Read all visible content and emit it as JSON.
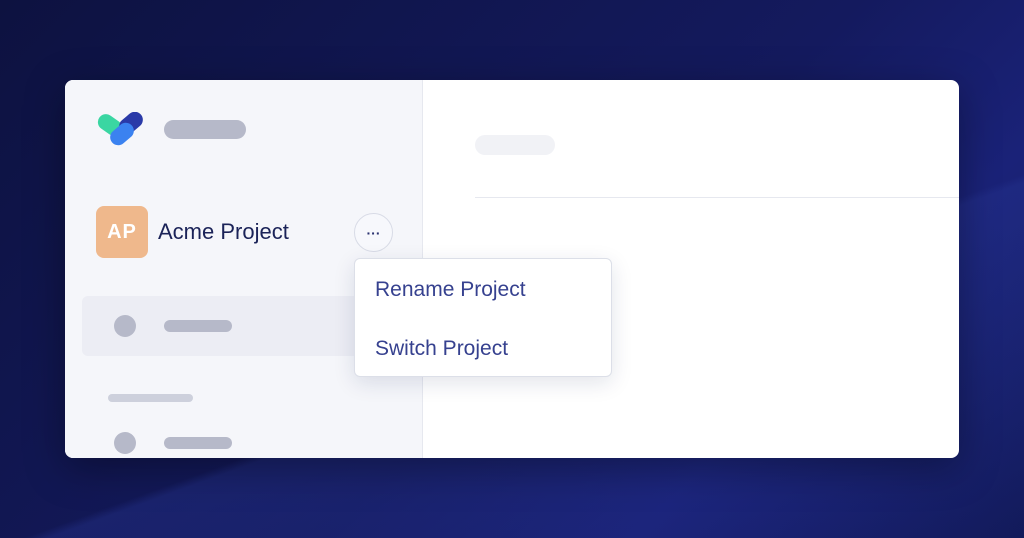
{
  "sidebar": {
    "project": {
      "initials": "AP",
      "name": "Acme Project",
      "avatar_color": "#efb88c"
    },
    "more_button_glyph": "···"
  },
  "context_menu": {
    "items": [
      {
        "label": "Rename Project"
      },
      {
        "label": "Switch Project"
      }
    ]
  },
  "colors": {
    "background": "#141a5e",
    "menu_text": "#36418f",
    "project_text": "#1b2358"
  },
  "icons": {
    "logo": "brand-logo-icon",
    "more": "more-dots-icon"
  }
}
